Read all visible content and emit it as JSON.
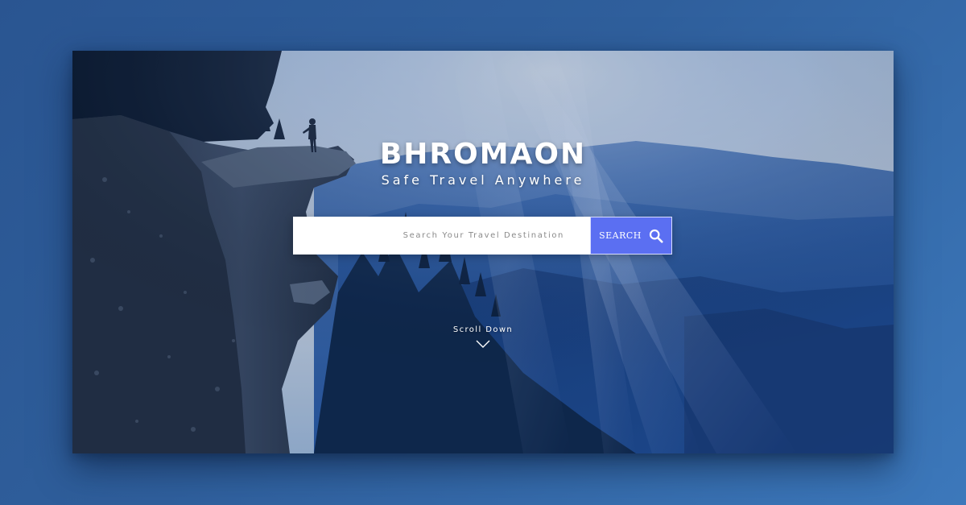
{
  "hero": {
    "brand": "BHROMAON",
    "tagline": "Safe Travel Anywhere",
    "background_image": "cliff-overlooking-forest-valley"
  },
  "search": {
    "placeholder": "Search Your Travel Destination",
    "value": "",
    "button_label": "SEARCH",
    "button_icon": "search-icon"
  },
  "scroll": {
    "label": "Scroll Down",
    "icon": "chevron-down-icon"
  },
  "colors": {
    "page_background": "#2f5f9c",
    "search_button": "#5b6ff2",
    "sky": "#c9d6e3",
    "mountain": "#2c5ea6"
  }
}
